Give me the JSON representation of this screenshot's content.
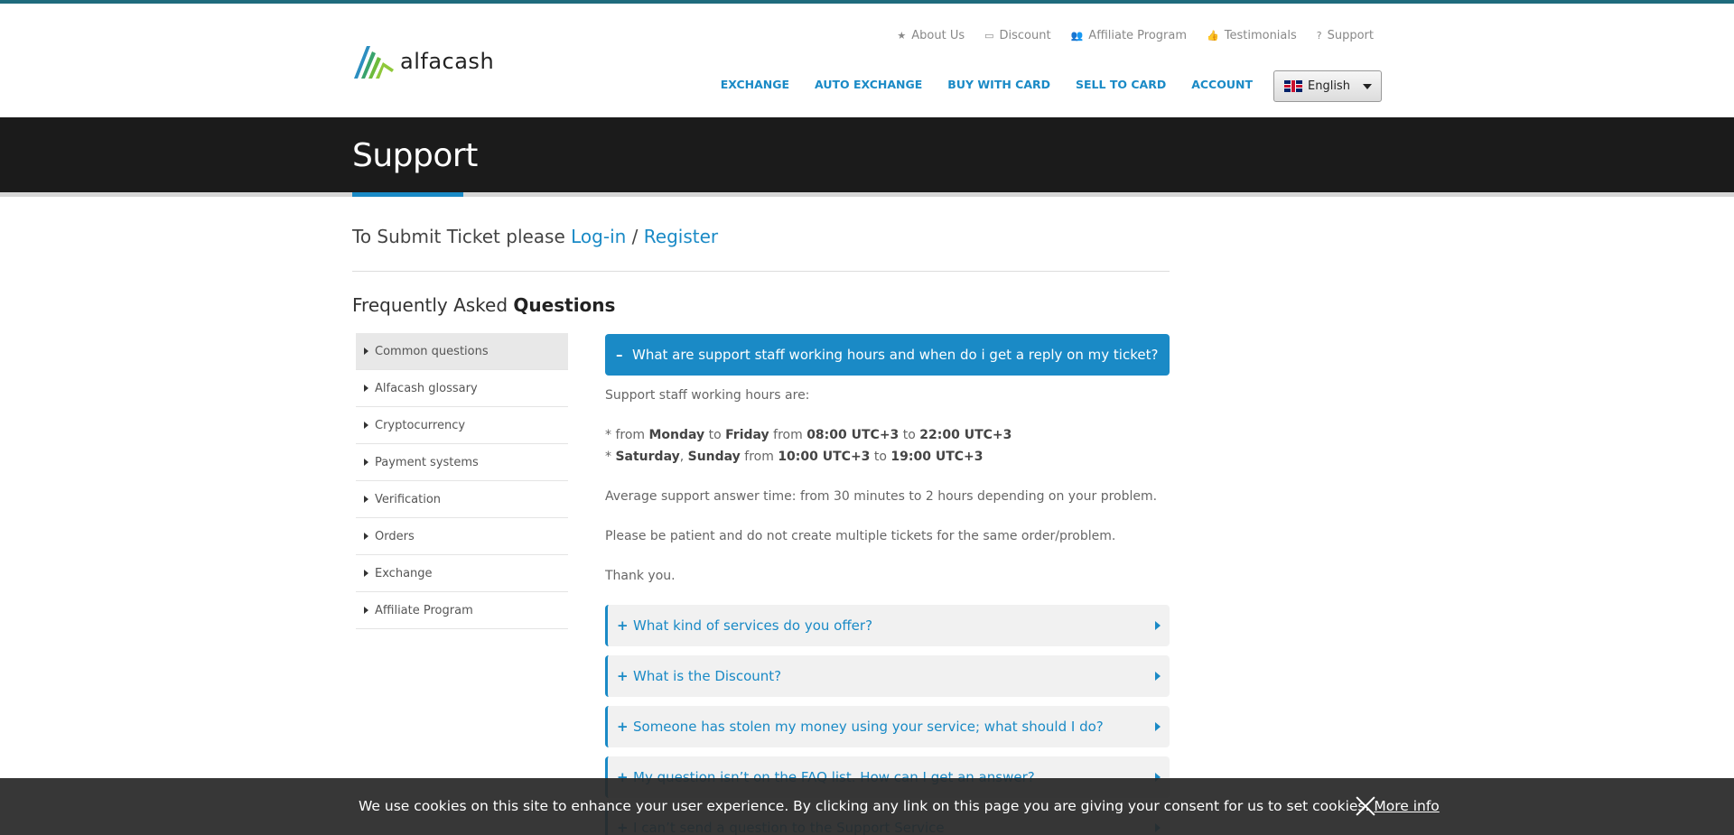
{
  "brand": {
    "name": "alfacash"
  },
  "top_links": [
    {
      "icon": "star-icon",
      "glyph": "★",
      "label": "About Us"
    },
    {
      "icon": "discount-icon",
      "glyph": "▭",
      "label": "Discount"
    },
    {
      "icon": "users-icon",
      "glyph": "👥",
      "label": "Affiliate Program"
    },
    {
      "icon": "thumbs-up-icon",
      "glyph": "👍",
      "label": "Testimonials"
    },
    {
      "icon": "question-icon",
      "glyph": "?",
      "label": "Support"
    }
  ],
  "main_nav": [
    "EXCHANGE",
    "AUTO EXCHANGE",
    "BUY WITH CARD",
    "SELL TO CARD",
    "ACCOUNT"
  ],
  "language": {
    "selected": "English"
  },
  "page": {
    "title": "Support"
  },
  "submit": {
    "prefix": "To Submit Ticket please",
    "login": "Log-in",
    "sep": "/",
    "register": "Register"
  },
  "faq": {
    "title_prefix": "Frequently Asked",
    "title_bold": "Questions",
    "categories": [
      "Common questions",
      "Alfacash glossary",
      "Cryptocurrency",
      "Payment systems",
      "Verification",
      "Orders",
      "Exchange",
      "Affiliate Program"
    ],
    "open_question": {
      "symbol": "–",
      "text": "What are support staff working hours and when do i get a reply on my ticket?",
      "intro": "Support staff working hours are:",
      "line1": {
        "star": "* from",
        "d1": "Monday",
        "to1": "to",
        "d2": "Friday",
        "from": "from",
        "t1": "08:00 UTC+3",
        "to2": "to",
        "t2": "22:00 UTC+3"
      },
      "line2": {
        "star": "*",
        "d1": "Saturday",
        "comma": ",",
        "d2": "Sunday",
        "from": "from",
        "t1": "10:00 UTC+3",
        "to": "to",
        "t2": "19:00 UTC+3"
      },
      "avg": "Average support answer time: from 30 minutes to 2 hours depending on your problem.",
      "patient": "Please be patient and do not create multiple tickets for the same order/problem.",
      "thanks": "Thank you."
    },
    "closed_questions": [
      "What kind of services do you offer?",
      "What is the Discount?",
      "Someone has stolen my money using your service; what should I do?",
      "My question isn’t on the FAQ list. How can I get an answer?",
      "I can’t send a question to the Support Service"
    ],
    "closed_symbol": "+"
  },
  "cookie": {
    "text": "We use cookies on this site to enhance your user experience. By clicking any link on this page you are giving your consent for us to set cookies.",
    "more": "More info"
  },
  "colors": {
    "accent": "#1a8ac6",
    "banner": "#1b1b1b",
    "topbar": "#1f6b7d"
  }
}
